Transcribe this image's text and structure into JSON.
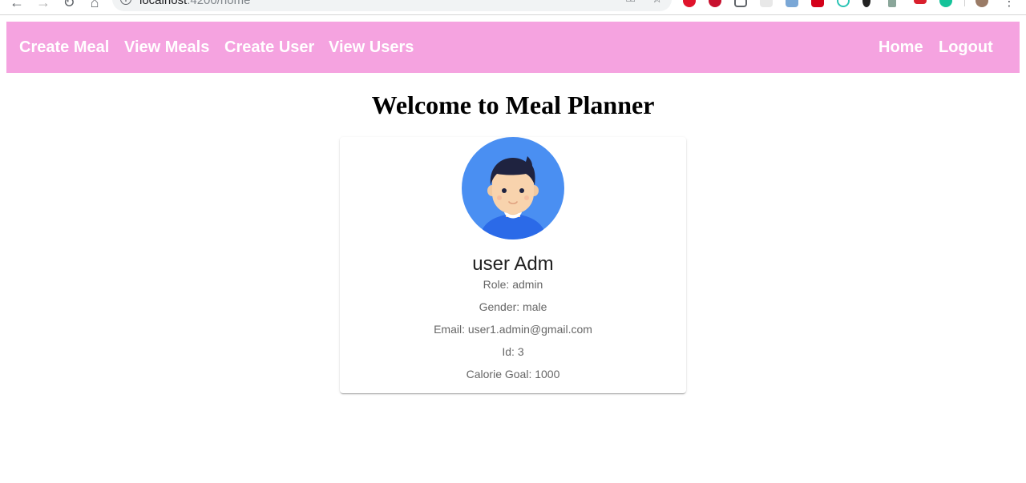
{
  "browser": {
    "url_host": "localhost",
    "url_path": ":4200/home"
  },
  "nav": {
    "left_links": [
      "Create Meal",
      "View Meals",
      "Create User",
      "View Users"
    ],
    "right_links": [
      "Home",
      "Logout"
    ]
  },
  "page_title": "Welcome to Meal Planner",
  "profile": {
    "name": "user Adm",
    "role": "Role: admin",
    "gender": "Gender: male",
    "email": "Email: user1.admin@gmail.com",
    "id": "Id: 3",
    "calorie_goal": "Calorie Goal: 1000"
  },
  "colors": {
    "navbar": "#f5a3e0",
    "avatar_bg": "#4a8ff2",
    "shirt": "#2b6ae8"
  }
}
